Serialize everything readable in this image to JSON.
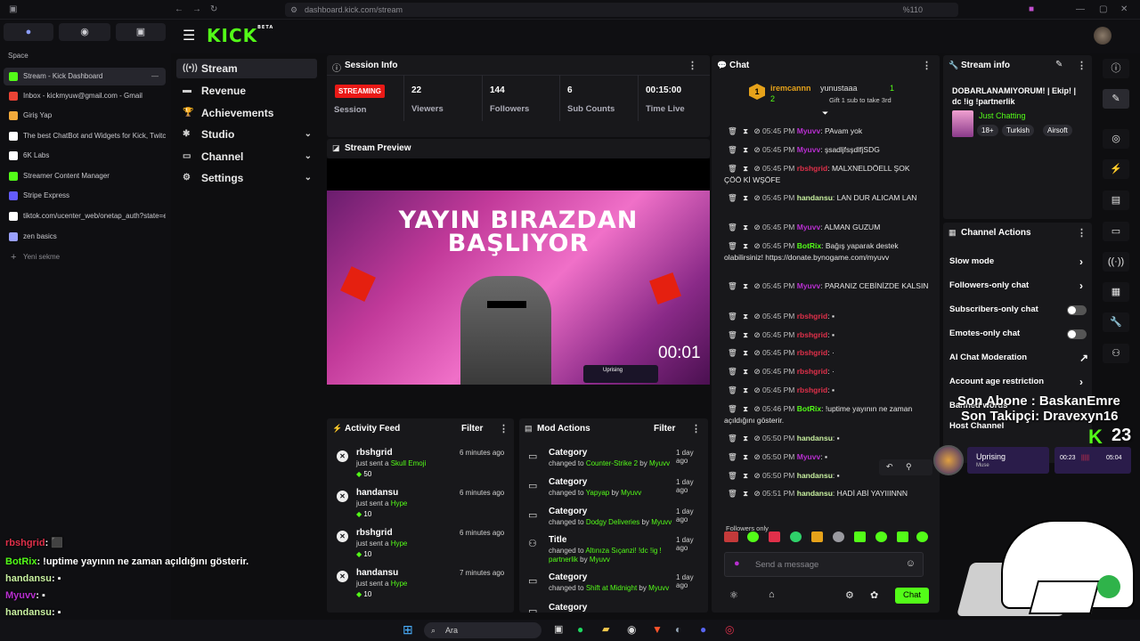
{
  "browser": {
    "url": "dashboard.kick.com/stream",
    "zoom": "%110",
    "space_label": "Space",
    "new_tab": "Yeni sekme",
    "tabs": [
      {
        "label": "Stream - Kick Dashboard",
        "color": "#53fc18"
      },
      {
        "label": "Inbox - kickmyuw@gmail.com - Gmail",
        "color": "#ea4335"
      },
      {
        "label": "Giriş Yap",
        "color": "#f2a93b"
      },
      {
        "label": "The best ChatBot and Widgets for Kick, Twitch,",
        "color": "#ffffff"
      },
      {
        "label": "6K Labs",
        "color": "#ffffff"
      },
      {
        "label": "Streamer Content Manager",
        "color": "#53fc18"
      },
      {
        "label": "Stripe Express",
        "color": "#635bff"
      },
      {
        "label": "tiktok.com/ucenter_web/onetap_auth?state=ey",
        "color": "#ffffff"
      },
      {
        "label": "zen basics",
        "color": "#9aa0ff"
      }
    ]
  },
  "overlay_chat": [
    {
      "user": "rbshgrid",
      "text": ": ⬛",
      "color": "#e0304a"
    },
    {
      "user": "BotRix",
      "text": ": !uptime yayının ne zaman açıldığını gösterir.",
      "color": "#53fc18"
    },
    {
      "user": "handansu",
      "text": ": ▪",
      "color": "#c8f0a0"
    },
    {
      "user": "Myuvv",
      "text": ": ▪",
      "color": "#b82fd0"
    },
    {
      "user": "handansu",
      "text": ": ▪",
      "color": "#c8f0a0"
    },
    {
      "user": "handansu",
      "text": ": HADİ ABİ YAYIIINNN",
      "color": "#c8f0a0"
    }
  ],
  "kick": {
    "logo": "KICK",
    "beta": "BETA"
  },
  "nav": {
    "items": [
      {
        "label": "Stream",
        "icon": "((•))",
        "chevron": ""
      },
      {
        "label": "Revenue",
        "icon": "▬",
        "chevron": ""
      },
      {
        "label": "Achievements",
        "icon": "🏆",
        "chevron": ""
      },
      {
        "label": "Studio",
        "icon": "✱",
        "chevron": "⌄"
      },
      {
        "label": "Channel",
        "icon": "▭",
        "chevron": "⌄"
      },
      {
        "label": "Settings",
        "icon": "⚙",
        "chevron": "⌄"
      }
    ]
  },
  "session": {
    "title": "Session Info",
    "badge": "STREAMING",
    "session_label": "Session",
    "stats": [
      {
        "value": "22",
        "label": "Viewers"
      },
      {
        "value": "144",
        "label": "Followers"
      },
      {
        "value": "6",
        "label": "Sub Counts"
      },
      {
        "value": "00:15:00",
        "label": "Time Live"
      }
    ]
  },
  "preview": {
    "title": "Stream Preview",
    "overlay_line1": "YAYIN BIRAZDAN",
    "overlay_line2": "BAŞLIYOR",
    "timer": "00:01",
    "mini_song": "Uprising"
  },
  "activity": {
    "title": "Activity Feed",
    "filter": "Filter",
    "items": [
      {
        "name": "rbshgrid",
        "pre": "just sent a ",
        "item": "Skull Emoji",
        "amount": "50",
        "time": "6 minutes ago"
      },
      {
        "name": "handansu",
        "pre": "just sent a ",
        "item": "Hype",
        "amount": "10",
        "time": "6 minutes ago"
      },
      {
        "name": "rbshgrid",
        "pre": "just sent a ",
        "item": "Hype",
        "amount": "10",
        "time": "6 minutes ago"
      },
      {
        "name": "handansu",
        "pre": "just sent a ",
        "item": "Hype",
        "amount": "10",
        "time": "7 minutes ago"
      }
    ]
  },
  "mod": {
    "title": "Mod Actions",
    "filter": "Filter",
    "items": [
      {
        "kind": "Category",
        "pre": "changed to ",
        "val": "Counter-Strike 2",
        "by": "Myuvv",
        "time": "1 day ago"
      },
      {
        "kind": "Category",
        "pre": "changed to ",
        "val": "Yapyap",
        "by": "Myuvv",
        "time": "1 day ago"
      },
      {
        "kind": "Category",
        "pre": "changed to ",
        "val": "Dodgy Deliveries",
        "by": "Myuvv",
        "time": "1 day ago"
      },
      {
        "kind": "Title",
        "pre": "changed to ",
        "val": "Altınıza Sıçanzi! !dc !ig ! partnerlik",
        "by": "Myuvv",
        "time": "1 day ago"
      },
      {
        "kind": "Category",
        "pre": "changed to ",
        "val": "Shift at Midnight",
        "by": "Myuvv",
        "time": "1 day ago"
      },
      {
        "kind": "Category",
        "pre": "",
        "val": "",
        "by": "",
        "time": ""
      }
    ]
  },
  "chat": {
    "title": "Chat",
    "top_user": "iremcannn",
    "top_count": "2",
    "gifter": "yunustaaa",
    "gifter_count": "1",
    "gift_text": "Gift 1 sub to take 3rd",
    "messages": [
      {
        "ts": "05:45 PM",
        "user": "Myuvv",
        "cls": "u-purple",
        "text": ": PAvam yok"
      },
      {
        "ts": "05:45 PM",
        "user": "Myuvv",
        "cls": "u-purple",
        "text": ": şsadljfsşdlfjSDG"
      },
      {
        "ts": "05:45 PM",
        "user": "rbshgrid",
        "cls": "u-red",
        "text": ": MALXNELDÖELL ŞOK ÇÖÖ Kİ WŞÖFE"
      },
      {
        "ts": "05:45 PM",
        "user": "handansu",
        "cls": "u-green",
        "text": ": LAN DUR ALICAM LAN"
      },
      {
        "ts": "05:45 PM",
        "user": "Myuvv",
        "cls": "u-purple",
        "text": ": ALMAN GUZUM"
      },
      {
        "ts": "05:45 PM",
        "user": "BotRix",
        "cls": "u-bot",
        "text": ": Bağış yaparak destek olabilirsiniz! https://donate.bynogame.com/myuvv"
      },
      {
        "ts": "05:45 PM",
        "user": "Myuvv",
        "cls": "u-purple",
        "text": ": PARANIZ CEBİNİZDE KALSIN"
      },
      {
        "ts": "05:45 PM",
        "user": "rbshgrid",
        "cls": "u-red",
        "text": ": ▪"
      },
      {
        "ts": "05:45 PM",
        "user": "rbshgrid",
        "cls": "u-red",
        "text": ": ▪"
      },
      {
        "ts": "05:45 PM",
        "user": "rbshgrid",
        "cls": "u-red",
        "text": ": ·"
      },
      {
        "ts": "05:45 PM",
        "user": "rbshgrid",
        "cls": "u-red",
        "text": ": ·"
      },
      {
        "ts": "05:45 PM",
        "user": "rbshgrid",
        "cls": "u-red",
        "text": ": ▪"
      },
      {
        "ts": "05:46 PM",
        "user": "BotRix",
        "cls": "u-bot",
        "text": ": !uptime yayının ne zaman açıldığını gösterir."
      },
      {
        "ts": "05:50 PM",
        "user": "handansu",
        "cls": "u-green",
        "text": ": ▪"
      },
      {
        "ts": "05:50 PM",
        "user": "Myuvv",
        "cls": "u-purple",
        "text": ": ▪"
      },
      {
        "ts": "05:50 PM",
        "user": "handansu",
        "cls": "u-green",
        "text": ": ▪"
      },
      {
        "ts": "05:51 PM",
        "user": "handansu",
        "cls": "u-green",
        "text": ": HADİ ABİ YAYIIINNN"
      }
    ],
    "followers_only": "Followers only",
    "placeholder": "Send a message",
    "send": "Chat"
  },
  "streaminfo": {
    "title": "Stream info",
    "stream_title": "DOBARLANAMIYORUM! | Ekip! | dc !ig !partnerlik",
    "category": "Just Chatting",
    "tags": [
      "18+",
      "Turkish",
      "Airsoft"
    ]
  },
  "actions": {
    "title": "Channel Actions",
    "items": [
      {
        "label": "Slow mode",
        "ctrl": "›"
      },
      {
        "label": "Followers-only chat",
        "ctrl": "›"
      },
      {
        "label": "Subscribers-only chat",
        "ctrl": "toggle"
      },
      {
        "label": "Emotes-only chat",
        "ctrl": "toggle"
      },
      {
        "label": "AI Chat Moderation",
        "ctrl": "↗"
      },
      {
        "label": "Account age restriction",
        "ctrl": "›"
      },
      {
        "label": "Banned words",
        "ctrl": ""
      },
      {
        "label": "Host Channel",
        "ctrl": ""
      }
    ]
  },
  "overlay": {
    "sub_line": "Son Abone : BaskanEmre",
    "follow_line": "Son Takipçi: Dravexyn16",
    "viewer_count": "23",
    "song": "Uprising",
    "song_sub": "Muse",
    "t1": "00:23",
    "t2": "05:04"
  },
  "taskbar": {
    "search": "Ara"
  },
  "colors": {
    "accent": "#53fc18",
    "bg": "#0e0e10",
    "panel": "#18181b",
    "streaming": "#e91916"
  }
}
